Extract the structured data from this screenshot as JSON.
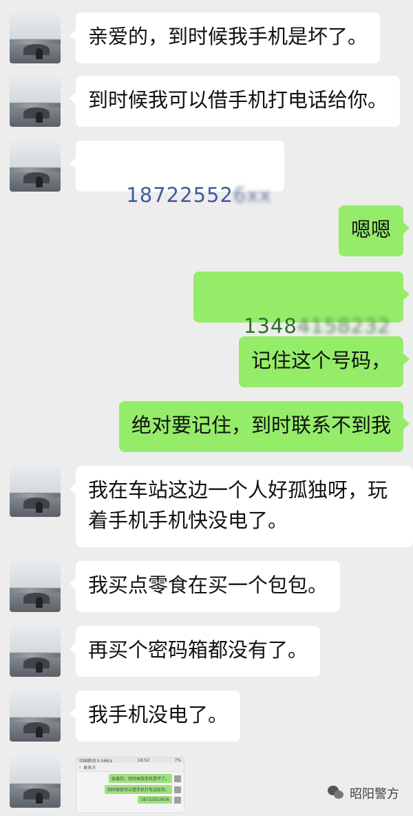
{
  "messages": [
    {
      "side": "left",
      "text": "亲爱的，到时候我手机是坏了。"
    },
    {
      "side": "left",
      "text": "到时候我可以借手机打电话给你。"
    },
    {
      "side": "left",
      "phone_visible": "18722552",
      "phone_blurred": "6xx"
    },
    {
      "side": "right",
      "text": "嗯嗯"
    },
    {
      "side": "right",
      "phone_visible": "1348",
      "phone_blurred": "4158232"
    },
    {
      "side": "right",
      "text": "记住这个号码，"
    },
    {
      "side": "right",
      "text": "绝对要记住，到时联系不到我"
    },
    {
      "side": "left",
      "text": "我在车站这边一个人好孤独呀，玩\n着手机手机快没电了。"
    },
    {
      "side": "left",
      "text": "我买点零食在买一个包包。"
    },
    {
      "side": "left",
      "text": "再买个密码箱都没有了。"
    },
    {
      "side": "left",
      "text": "我手机没电了。"
    }
  ],
  "screenshot": {
    "status_left": "中国移动 0.56K/s",
    "status_center": "18:52",
    "status_right": "7%",
    "back_label": "‹",
    "contact": "联系方",
    "lines": [
      "亲爱的，到时候我手机是坏了。",
      "到时候我可以借手机打电话给你。",
      "18722552636"
    ]
  },
  "watermark": {
    "text": "昭阳警方",
    "icon": "wechat-icon"
  },
  "colors": {
    "background": "#ededed",
    "left_bubble": "#ffffff",
    "right_bubble": "#95ec69"
  }
}
